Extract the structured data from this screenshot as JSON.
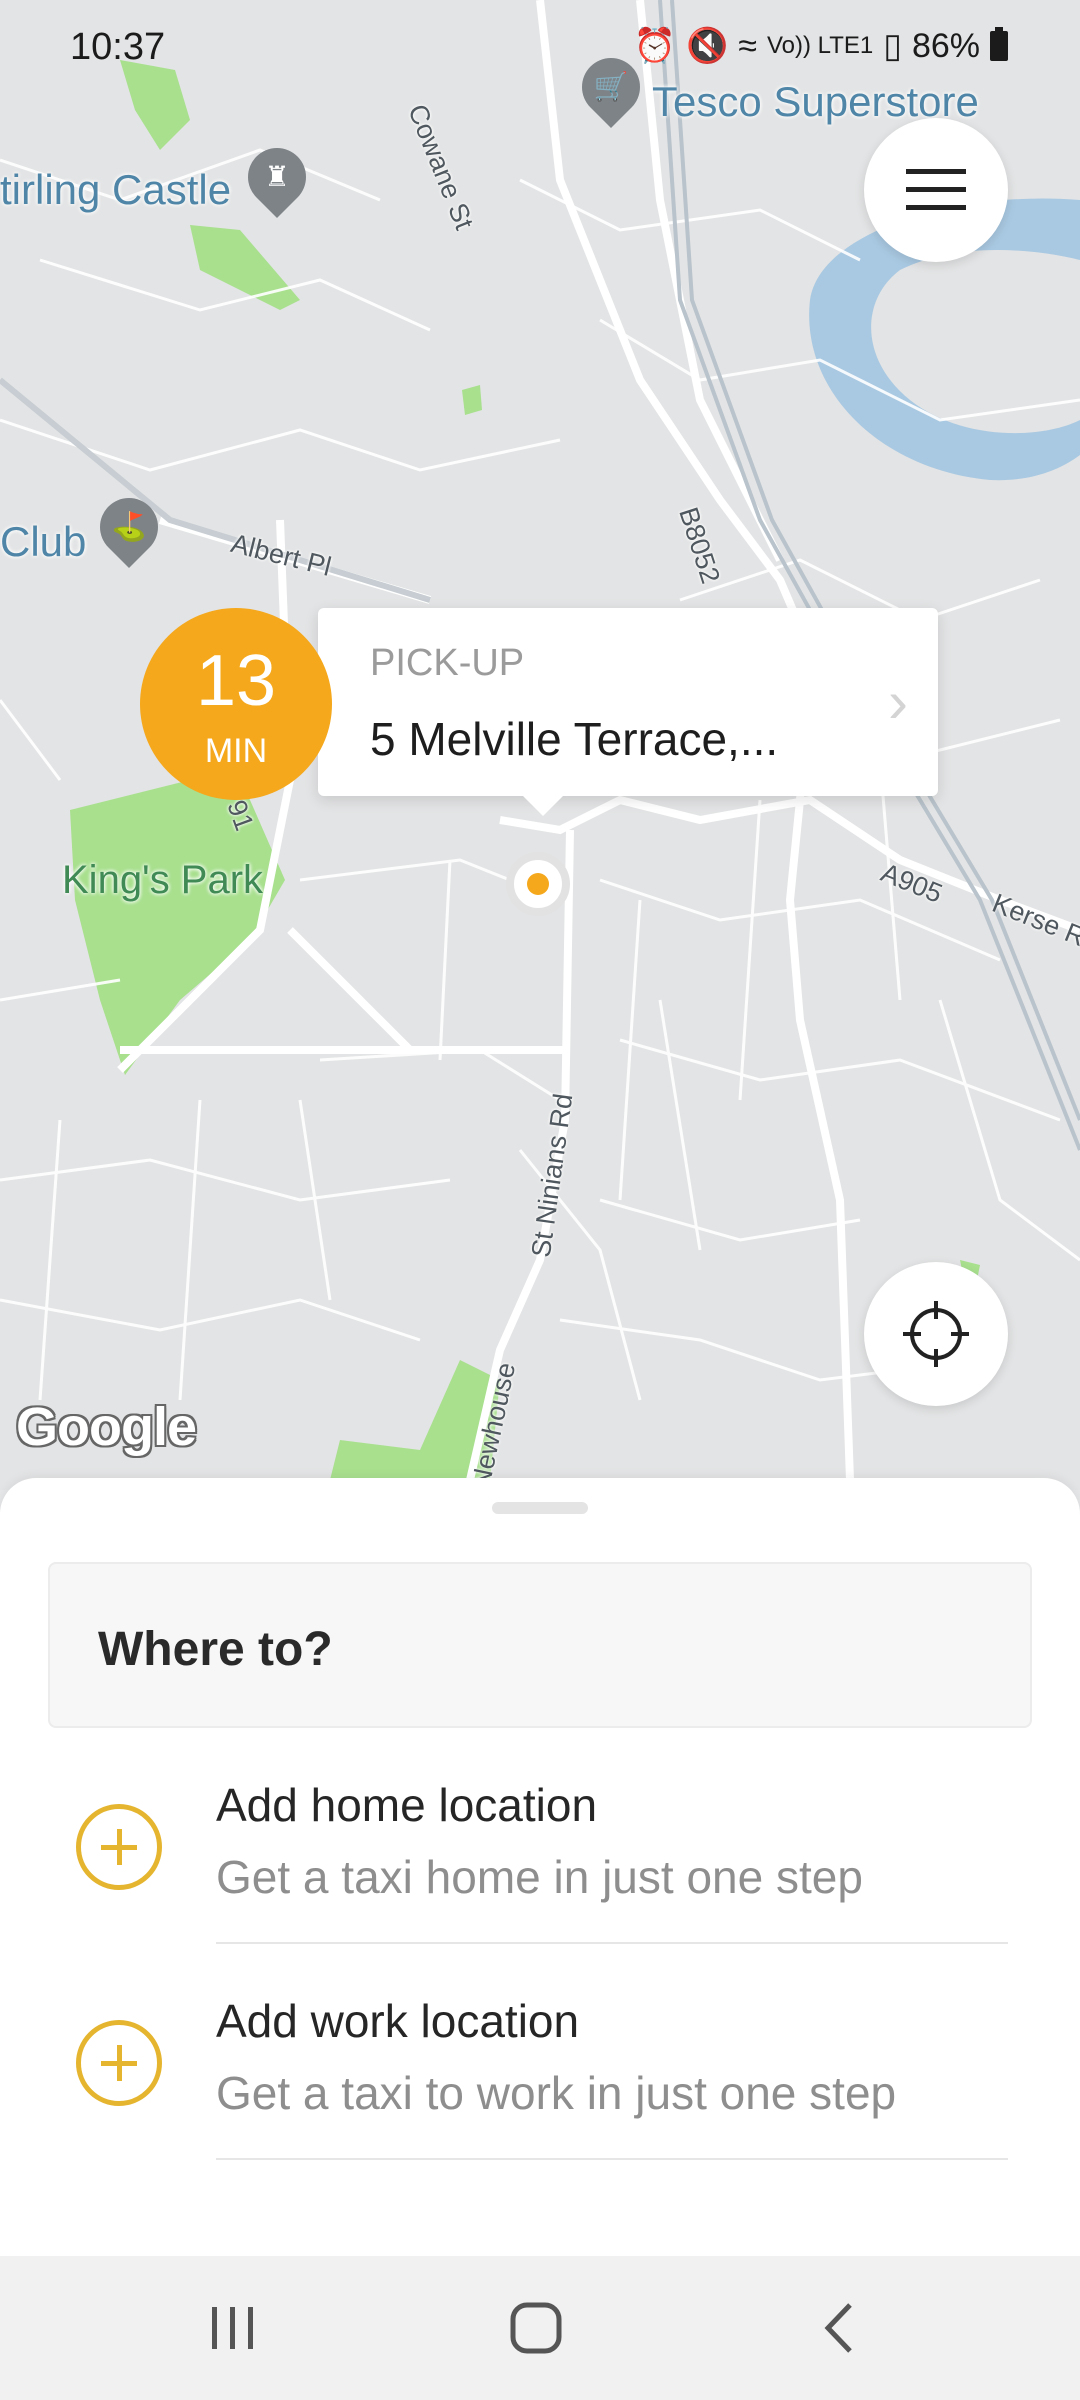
{
  "status_bar": {
    "time": "10:37",
    "network_label": "Vo)) LTE1",
    "battery": "86%"
  },
  "map": {
    "pois": [
      {
        "name": "Tesco Superstore",
        "icon": "cart-icon"
      },
      {
        "name": "tirling Castle",
        "icon": "castle-icon"
      },
      {
        "name": "Club",
        "icon": "golf-icon"
      }
    ],
    "streets": {
      "cowane": "Cowane St",
      "albert": "Albert Pl",
      "b8052": "B8052",
      "a905": "A905",
      "kerse": "Kerse R",
      "st_ninians": "St Ninians Rd",
      "newhouse": "Newhouse",
      "partial": "91"
    },
    "parks": {
      "kings_park": "King's Park"
    },
    "attribution": "Google",
    "colors": {
      "land": "#e3e4e5",
      "park": "#a8e08e",
      "water": "#a9c9e2",
      "road": "#ffffff"
    }
  },
  "pickup": {
    "label": "PICK-UP",
    "address": "5 Melville Terrace,...",
    "eta_value": "13",
    "eta_unit": "MIN",
    "accent_color": "#f5a81c"
  },
  "controls": {
    "menu_icon": "hamburger-menu-icon",
    "locate_icon": "crosshair-icon"
  },
  "sheet": {
    "search_placeholder": "Where to?",
    "shortcuts": [
      {
        "title": "Add home location",
        "subtitle": "Get a taxi home in just one step",
        "icon": "plus-circle-icon"
      },
      {
        "title": "Add work location",
        "subtitle": "Get a taxi to work in just one step",
        "icon": "plus-circle-icon"
      }
    ]
  },
  "nav_bar": {
    "icons": [
      "recent-apps-icon",
      "home-icon",
      "back-icon"
    ]
  }
}
